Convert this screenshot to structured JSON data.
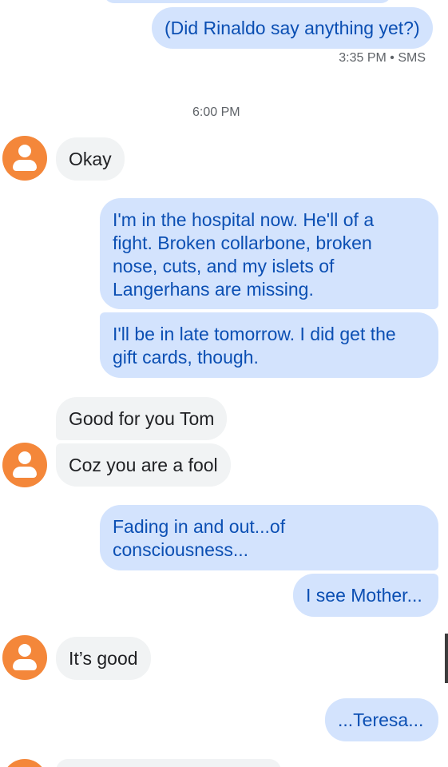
{
  "messages": {
    "m0": "(Did Rinaldo say anything yet?)",
    "m0_meta": "3:35 PM • SMS",
    "divider_time": "6:00 PM",
    "m1": "Okay",
    "m2_line1": "I'm in the hospital now.  He'll of a",
    "m2_line2": "fight.   Broken collarbone, broken",
    "m2_line3": "nose, cuts, and my islets of",
    "m2_line4": "Langerhans are missing.",
    "m3_line1": "I'll be in late tomorrow.  I did get the",
    "m3_line2": "gift cards, though.",
    "m4": "Good for you Tom",
    "m5": "Coz you are a fool",
    "m6_line1": "Fading in and out...of",
    "m6_line2": "consciousness...",
    "m7": "I see Mother...",
    "m8": "It’s good",
    "m9": "...Teresa..."
  },
  "colors": {
    "outgoing_bg": "#d3e3fd",
    "outgoing_text": "#0b4fb3",
    "incoming_bg": "#f1f3f4",
    "incoming_text": "#202124",
    "avatar": "#f4873a"
  },
  "icons": {
    "avatar": "person-icon"
  }
}
